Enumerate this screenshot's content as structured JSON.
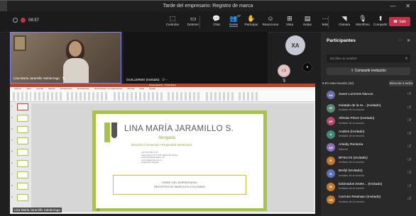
{
  "window": {
    "title": "Tarde del empresario: Registro de marca",
    "minimize": "—",
    "close": "✕"
  },
  "toolbar": {
    "timer": "08:57",
    "buttons": [
      {
        "name": "chat-toggle",
        "icon": "⬚",
        "label": "Controlar"
      },
      {
        "name": "stop-share",
        "icon": "▭",
        "label": "Detener"
      },
      {
        "name": "chat",
        "icon": "💬",
        "label": "Chat"
      },
      {
        "name": "people",
        "icon": "👥",
        "label": "Gente",
        "badge": "47"
      },
      {
        "name": "raise",
        "icon": "✋",
        "label": "Participar"
      },
      {
        "name": "react",
        "icon": "☺",
        "label": "Reaccionar"
      },
      {
        "name": "view",
        "icon": "⊞",
        "label": "Vista"
      },
      {
        "name": "notes",
        "icon": "▤",
        "label": "Notas"
      },
      {
        "name": "more",
        "icon": "···",
        "label": "Más"
      },
      {
        "name": "camera",
        "icon": "◥",
        "label": "Cámara"
      },
      {
        "name": "mic",
        "icon": "🎙",
        "label": "Micrófono"
      },
      {
        "name": "share",
        "icon": "⬆",
        "label": "Compartir"
      }
    ],
    "leave_label": "Salir"
  },
  "tiles": {
    "lina_label": "Lina María Jaramillo Saldarriaga",
    "guillermo_label": "GUILLERMO (Invitado)",
    "xa_initials": "XA",
    "ls_initials": "LS"
  },
  "share": {
    "ppt_title": "Presentación1 - PowerPoint",
    "menu": [
      "Archivo",
      "Inicio",
      "Insertar",
      "Diseño",
      "Transiciones",
      "Animaciones",
      "Presentación con diapositivas",
      "Revisar",
      "Vista",
      "Ayuda"
    ],
    "slide": {
      "name": "LINA MARÍA JARAMILLO S.",
      "role": "Abogada",
      "specialty": "Derecho Comercial • Propiedad Intelectual",
      "contact": [
        "(+57) 321 652 72 61",
        "Calle 18 #40 1-8 Of. 205, Edificio del Parque",
        "linajaramillo@abogados.com",
        "www.linajaramillo.com.co",
        "linajaramillo.abogada"
      ],
      "box_line1": "TARDE DEL EMPRESARIO:",
      "box_line2": "REGISTRO DE MARCA EN COLOMBIA"
    },
    "presenter_label": "Lina María Jaramillo Saldarriaga",
    "thumb_count": 9
  },
  "panel": {
    "title": "Participantes",
    "search_placeholder": "Escribe un nombre",
    "invite_label": "Compartir invitación",
    "section_label": "En esta reunión (42)",
    "silence_label": "Silenciar a todos",
    "participants": [
      {
        "initials": "XA",
        "name": "Xaver Lommet Alarcon",
        "sub": "",
        "color": "#6b6fa8"
      },
      {
        "initials": "IR",
        "name": "Invitado de la re... (Invitado)",
        "sub": "Invitado de la reunión",
        "color": "#5b8a72"
      },
      {
        "initials": "AP",
        "name": "Alfredo Pérez (Invitado)",
        "sub": "Invitado de la reunión",
        "color": "#b8476b"
      },
      {
        "initials": "A",
        "name": "Andres (Invitado)",
        "sub": "Invitado de la reunión",
        "color": "#3f8a7c"
      },
      {
        "initials": "AR",
        "name": "Arleidy Renteria",
        "sub": "Externo",
        "color": "#8a6fb8"
      },
      {
        "initials": "B",
        "name": "BFIELYS (Invitado)",
        "sub": "Invitado de la reunión",
        "color": "#c27a2e"
      },
      {
        "initials": "B",
        "name": "Berfyl (Invitado)",
        "sub": "Invitado de la reunión",
        "color": "#5d73b8"
      },
      {
        "initials": "BI",
        "name": "bobinados insele... (Invitado)",
        "sub": "Invitado de la reunión",
        "color": "#c27a2e"
      },
      {
        "initials": "CR",
        "name": "Carmen Restrepo (Invitado)",
        "sub": "Invitado de la reunión",
        "color": "#c27a2e"
      }
    ]
  }
}
